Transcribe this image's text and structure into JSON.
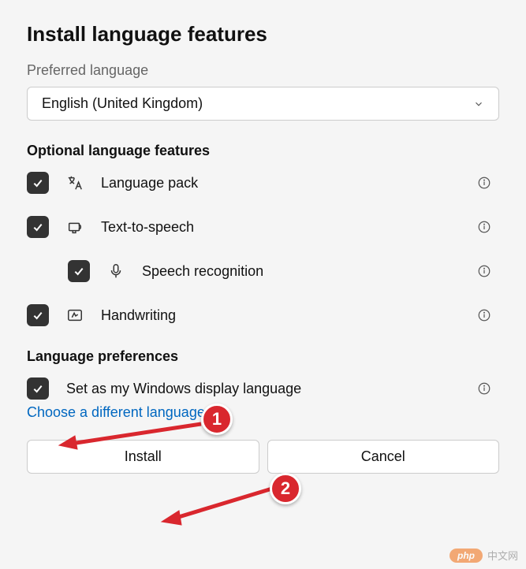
{
  "title": "Install language features",
  "preferred_label": "Preferred language",
  "language_value": "English (United Kingdom)",
  "optional_title": "Optional language features",
  "features": {
    "pack": "Language pack",
    "tts": "Text-to-speech",
    "speech": "Speech recognition",
    "handwriting": "Handwriting"
  },
  "preferences_title": "Language preferences",
  "display_lang": "Set as my Windows display language",
  "choose_link": "Choose a different language",
  "buttons": {
    "install": "Install",
    "cancel": "Cancel"
  },
  "annotations": {
    "one": "1",
    "two": "2"
  },
  "watermark": {
    "badge": "php",
    "text": "中文网"
  }
}
